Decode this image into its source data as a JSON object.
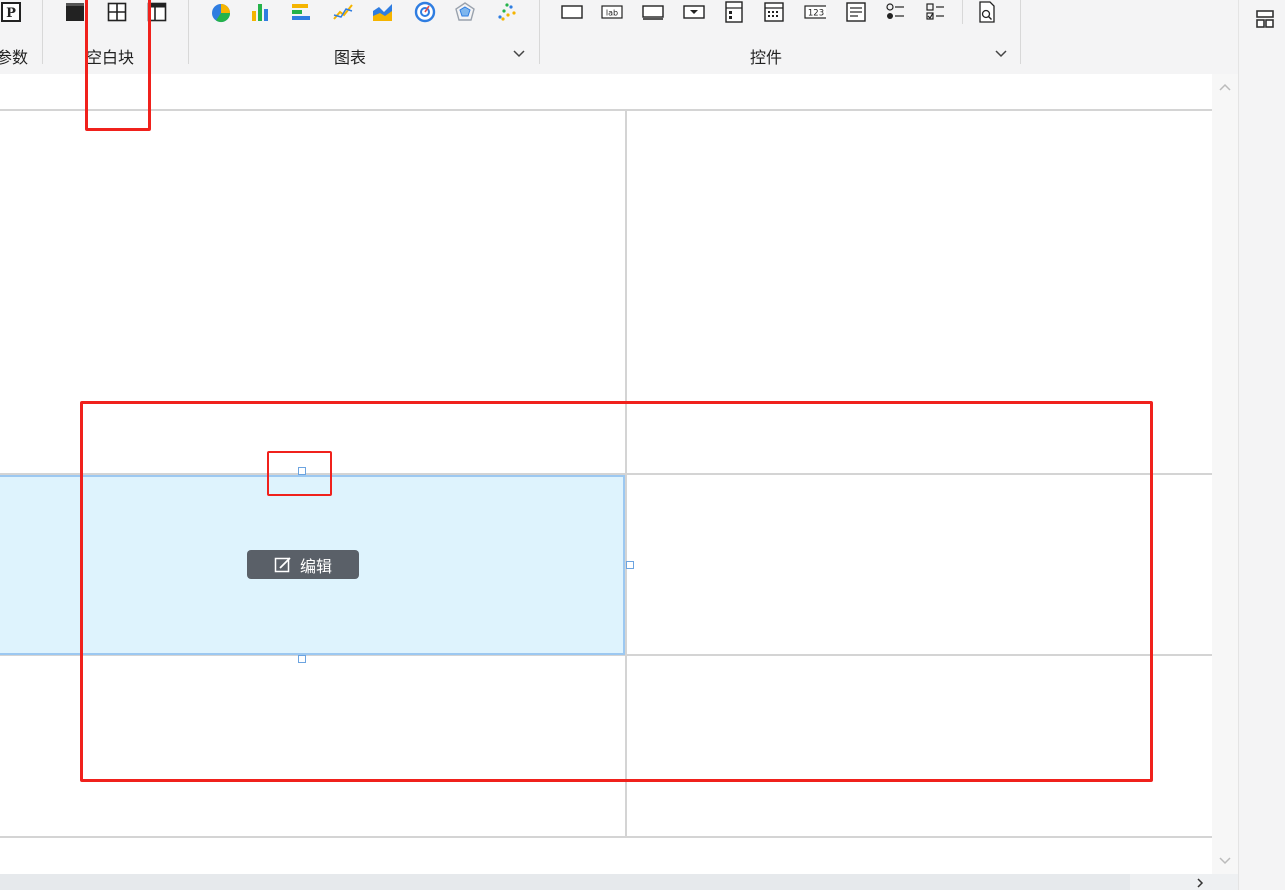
{
  "toolbar": {
    "groups": {
      "params": "参数",
      "blank": "空白块",
      "chart": "图表",
      "widget": "控件"
    },
    "widget_number_label": "123",
    "widget_label_label": "lab"
  },
  "canvas": {
    "edit_label": "编辑"
  },
  "colors": {
    "highlight": "#f0211c",
    "selection_fill": "#def3fd",
    "selection_border": "#9cc8f1"
  }
}
